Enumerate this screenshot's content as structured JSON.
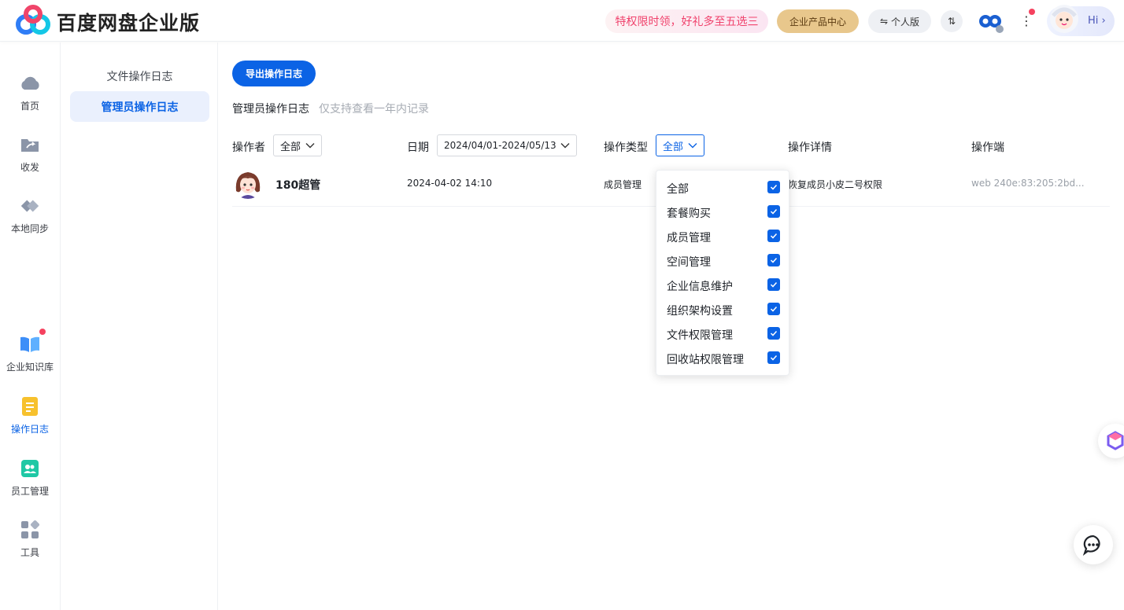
{
  "header": {
    "brand": "百度网盘企业版",
    "promo": "特权限时领，好礼多至五选三",
    "enterprise_center": "企业产品中心",
    "personal": "个人版",
    "hi": "Hi"
  },
  "rail": {
    "items": [
      {
        "label": "首页",
        "icon": "cloud-icon"
      },
      {
        "label": "收发",
        "icon": "folder-share-icon"
      },
      {
        "label": "本地同步",
        "icon": "sync-icon"
      },
      {
        "label": "企业知识库",
        "icon": "book-icon"
      },
      {
        "label": "操作日志",
        "icon": "log-icon"
      },
      {
        "label": "员工管理",
        "icon": "staff-icon"
      },
      {
        "label": "工具",
        "icon": "tools-icon"
      }
    ]
  },
  "subnav": {
    "items": [
      {
        "label": "文件操作日志"
      },
      {
        "label": "管理员操作日志"
      }
    ]
  },
  "main": {
    "export_label": "导出操作日志",
    "title": "管理员操作日志",
    "hint": "仅支持查看一年内记录",
    "filters": {
      "operator_label": "操作者",
      "operator_value": "全部",
      "date_label": "日期",
      "date_value": "2024/04/01-2024/05/13",
      "type_label": "操作类型",
      "type_value": "全部",
      "detail_label": "操作详情",
      "client_label": "操作端"
    },
    "rows": [
      {
        "operator": "180超管",
        "datetime": "2024-04-02 14:10",
        "type": "成员管理",
        "detail": "恢复成员小皮二号权限",
        "client": "web 240e:83:205:2bd..."
      }
    ],
    "type_options": [
      {
        "label": "全部",
        "checked": true
      },
      {
        "label": "套餐购买",
        "checked": true
      },
      {
        "label": "成员管理",
        "checked": true
      },
      {
        "label": "空间管理",
        "checked": true
      },
      {
        "label": "企业信息维护",
        "checked": true
      },
      {
        "label": "组织架构设置",
        "checked": true
      },
      {
        "label": "文件权限管理",
        "checked": true
      },
      {
        "label": "回收站权限管理",
        "checked": true
      }
    ]
  },
  "colors": {
    "accent": "#0b63e5",
    "promo_text": "#f0426c",
    "enterprise_pill": "#e8c78c"
  }
}
